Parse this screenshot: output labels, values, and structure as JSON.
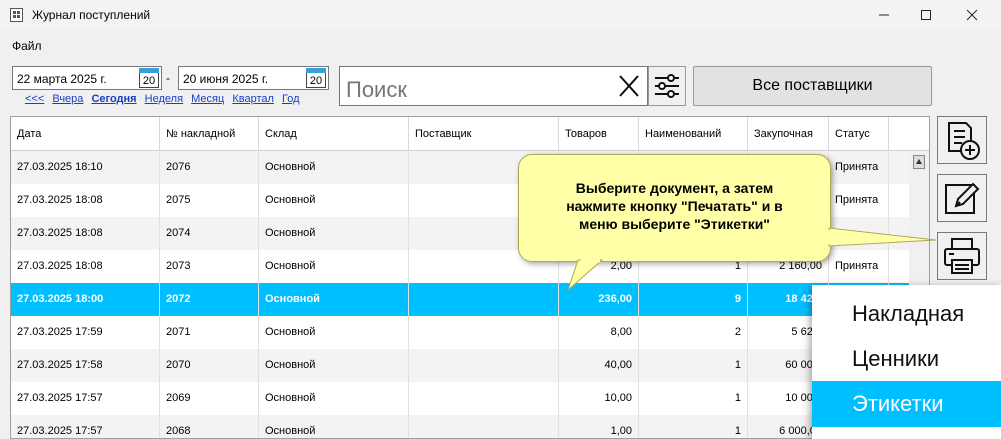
{
  "window": {
    "title": "Журнал поступлений"
  },
  "menu": {
    "file": "Файл"
  },
  "date_from": {
    "value": "22 марта 2025 г.",
    "cal_day": "20"
  },
  "date_separator": "-",
  "date_to": {
    "value": "20 июня 2025 г.",
    "cal_day": "20"
  },
  "periods": [
    "<<<",
    "Вчера",
    "Сегодня",
    "Неделя",
    "Месяц",
    "Квартал",
    "Год"
  ],
  "active_period": "Сегодня",
  "search": {
    "placeholder": "Поиск"
  },
  "suppliers_button": "Все поставщики",
  "columns": [
    "Дата",
    "№ накладной",
    "Склад",
    "Поставщик",
    "Товаров",
    "Наименований",
    "Закупочная",
    "Статус"
  ],
  "rows": [
    {
      "date": "27.03.2025 18:10",
      "num": "2076",
      "store": "Основной",
      "supplier": "",
      "goods": "",
      "items": "",
      "cost": "",
      "status": "Принята"
    },
    {
      "date": "27.03.2025 18:08",
      "num": "2075",
      "store": "Основной",
      "supplier": "",
      "goods": "",
      "items": "",
      "cost": "",
      "status": "Принята"
    },
    {
      "date": "27.03.2025 18:08",
      "num": "2074",
      "store": "Основной",
      "supplier": "",
      "goods": "",
      "items": "",
      "cost": "",
      "status": ""
    },
    {
      "date": "27.03.2025 18:08",
      "num": "2073",
      "store": "Основной",
      "supplier": "",
      "goods": "2,00",
      "items": "1",
      "cost": "2 160,00",
      "status": "Принята"
    },
    {
      "date": "27.03.2025 18:00",
      "num": "2072",
      "store": "Основной",
      "supplier": "",
      "goods": "236,00",
      "items": "9",
      "cost": "18 429,",
      "status": ""
    },
    {
      "date": "27.03.2025 17:59",
      "num": "2071",
      "store": "Основной",
      "supplier": "",
      "goods": "8,00",
      "items": "2",
      "cost": "5 628,",
      "status": ""
    },
    {
      "date": "27.03.2025 17:58",
      "num": "2070",
      "store": "Основной",
      "supplier": "",
      "goods": "40,00",
      "items": "1",
      "cost": "60 000,",
      "status": ""
    },
    {
      "date": "27.03.2025 17:57",
      "num": "2069",
      "store": "Основной",
      "supplier": "",
      "goods": "10,00",
      "items": "1",
      "cost": "10 000,",
      "status": ""
    },
    {
      "date": "27.03.2025 17:57",
      "num": "2068",
      "store": "Основной",
      "supplier": "",
      "goods": "1,00",
      "items": "1",
      "cost": "6 000,00",
      "status": "Принята"
    }
  ],
  "selected_row": 4,
  "callout": {
    "line1": "Выберите документ, а затем",
    "line2": "нажмите кнопку \"Печатать\" и в",
    "line3": "меню выберите \"Этикетки\""
  },
  "print_menu": [
    "Накладная",
    "Ценники",
    "Этикетки"
  ],
  "print_menu_highlighted": "Этикетки",
  "toolbar_icons": [
    "new-document-icon",
    "edit-icon",
    "printer-icon"
  ],
  "colors": {
    "selection": "#00bfff",
    "callout_bg": "#ffffa8",
    "calendar_accent": "#39a0d7",
    "link": "#1a3ec8"
  }
}
